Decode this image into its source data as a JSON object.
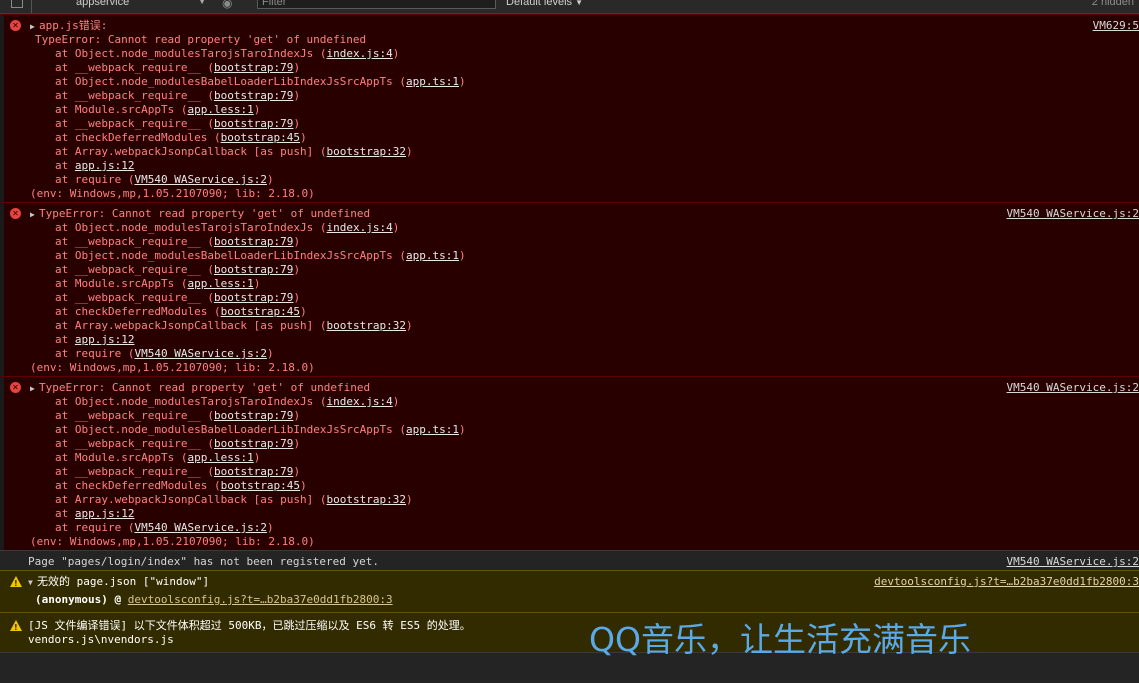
{
  "toolbar": {
    "context": "appservice",
    "filter_placeholder": "Filter",
    "levels": "Default levels",
    "hidden": "2 hidden"
  },
  "messages": [
    {
      "type": "error",
      "title_prefix": "app.js错误:",
      "title": "TypeError: Cannot read property 'get' of undefined",
      "source": "VM629:5",
      "stack": [
        {
          "fn": "at Object.node_modulesTarojsTaroIndexJs",
          "loc": "index.js:4"
        },
        {
          "fn": "at __webpack_require__",
          "loc": "bootstrap:79"
        },
        {
          "fn": "at Object.node_modulesBabelLoaderLibIndexJsSrcAppTs",
          "loc": "app.ts:1"
        },
        {
          "fn": "at __webpack_require__",
          "loc": "bootstrap:79"
        },
        {
          "fn": "at Module.srcAppTs",
          "loc": "app.less:1"
        },
        {
          "fn": "at __webpack_require__",
          "loc": "bootstrap:79"
        },
        {
          "fn": "at checkDeferredModules",
          "loc": "bootstrap:45"
        },
        {
          "fn": "at Array.webpackJsonpCallback [as push]",
          "loc": "bootstrap:32"
        },
        {
          "fn": "at",
          "loc": "app.js:12"
        },
        {
          "fn": "at require",
          "loc": "VM540 WAService.js:2"
        }
      ],
      "env": "(env: Windows,mp,1.05.2107090; lib: 2.18.0)"
    },
    {
      "type": "error",
      "title": "TypeError: Cannot read property 'get' of undefined",
      "source": "VM540 WAService.js:2",
      "stack": [
        {
          "fn": "at Object.node_modulesTarojsTaroIndexJs",
          "loc": "index.js:4"
        },
        {
          "fn": "at __webpack_require__",
          "loc": "bootstrap:79"
        },
        {
          "fn": "at Object.node_modulesBabelLoaderLibIndexJsSrcAppTs",
          "loc": "app.ts:1"
        },
        {
          "fn": "at __webpack_require__",
          "loc": "bootstrap:79"
        },
        {
          "fn": "at Module.srcAppTs",
          "loc": "app.less:1"
        },
        {
          "fn": "at __webpack_require__",
          "loc": "bootstrap:79"
        },
        {
          "fn": "at checkDeferredModules",
          "loc": "bootstrap:45"
        },
        {
          "fn": "at Array.webpackJsonpCallback [as push]",
          "loc": "bootstrap:32"
        },
        {
          "fn": "at",
          "loc": "app.js:12"
        },
        {
          "fn": "at require",
          "loc": "VM540 WAService.js:2"
        }
      ],
      "env": "(env: Windows,mp,1.05.2107090; lib: 2.18.0)"
    },
    {
      "type": "error",
      "title": "TypeError: Cannot read property 'get' of undefined",
      "source": "VM540 WAService.js:2",
      "stack": [
        {
          "fn": "at Object.node_modulesTarojsTaroIndexJs",
          "loc": "index.js:4"
        },
        {
          "fn": "at __webpack_require__",
          "loc": "bootstrap:79"
        },
        {
          "fn": "at Object.node_modulesBabelLoaderLibIndexJsSrcAppTs",
          "loc": "app.ts:1"
        },
        {
          "fn": "at __webpack_require__",
          "loc": "bootstrap:79"
        },
        {
          "fn": "at Module.srcAppTs",
          "loc": "app.less:1"
        },
        {
          "fn": "at __webpack_require__",
          "loc": "bootstrap:79"
        },
        {
          "fn": "at checkDeferredModules",
          "loc": "bootstrap:45"
        },
        {
          "fn": "at Array.webpackJsonpCallback [as push]",
          "loc": "bootstrap:32"
        },
        {
          "fn": "at",
          "loc": "app.js:12"
        },
        {
          "fn": "at require",
          "loc": "VM540 WAService.js:2"
        }
      ],
      "env": "(env: Windows,mp,1.05.2107090; lib: 2.18.0)"
    }
  ],
  "info_message": {
    "text": "Page \"pages/login/index\" has not been registered yet.",
    "source": "VM540 WAService.js:2"
  },
  "warn_page_json": {
    "title": "无效的 page.json [\"window\"]",
    "source": "devtoolsconfig.js?t=…b2ba37e0dd1fb2800:3",
    "detail_prefix": "(anonymous) @",
    "detail_link": "devtoolsconfig.js?t=…b2ba37e0dd1fb2800:3"
  },
  "warn_compile": {
    "line1": "[JS 文件编译错误] 以下文件体积超过 500KB，已跳过压缩以及 ES6 转 ES5 的处理。",
    "line2": "vendors.js\\nvendors.js"
  },
  "watermark": "QQ音乐，让生活充满音乐"
}
